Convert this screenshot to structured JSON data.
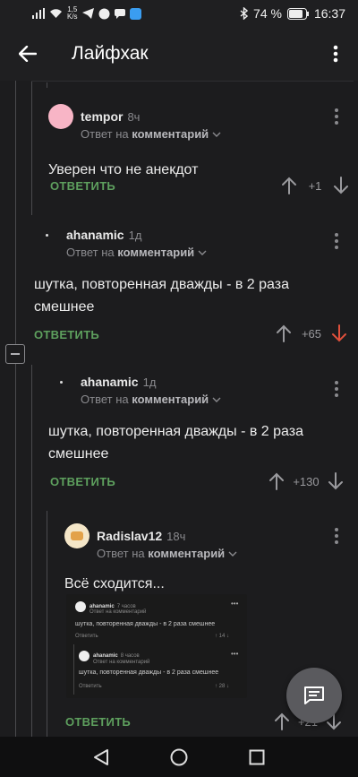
{
  "status": {
    "signal": "signal",
    "speed_top": "1,5",
    "speed_bottom": "K/s",
    "battery": "74 %",
    "time": "16:37"
  },
  "appbar": {
    "title": "Лайфхак"
  },
  "colors": {
    "reply_green": "#5ea05e",
    "downvote_red": "#e0503c",
    "background": "#1c1c1e"
  },
  "comments": [
    {
      "author": "tempor",
      "time": "8ч",
      "reply_prefix": "Ответ на",
      "reply_target": "комментарий",
      "text": "Уверен что не анекдот",
      "reply_label": "ОТВЕТИТЬ",
      "score": "+1",
      "avatar": "pink-circle"
    },
    {
      "author": "ahanamic",
      "time": "1д",
      "reply_prefix": "Ответ на",
      "reply_target": "комментарий",
      "text": "шутка, повторенная дважды - в 2 раза смешнее",
      "reply_label": "ОТВЕТИТЬ",
      "score": "+65",
      "downvoted": true
    },
    {
      "author": "ahanamic",
      "time": "1д",
      "reply_prefix": "Ответ на",
      "reply_target": "комментарий",
      "text": "шутка, повторенная дважды - в 2 раза смешнее",
      "reply_label": "ОТВЕТИТЬ",
      "score": "+130"
    },
    {
      "author": "Radislav12",
      "time": "18ч",
      "reply_prefix": "Ответ на",
      "reply_target": "комментарий",
      "text": "Всё сходится...",
      "reply_label": "ОТВЕТИТЬ",
      "score": "+21"
    }
  ],
  "embed": {
    "c1": {
      "author": "ahanamic",
      "time": "7 часов",
      "reply": "Ответ на комментарий",
      "text": "шутка, повторенная дважды - в 2 раза смешнее",
      "reply_label": "Ответить",
      "score": "14"
    },
    "c2": {
      "author": "ahanamic",
      "time": "8 часов",
      "reply": "Ответ на комментарий",
      "text": "шутка, повторенная дважды - в 2 раза смешнее",
      "reply_label": "Ответить",
      "score": "28"
    }
  }
}
